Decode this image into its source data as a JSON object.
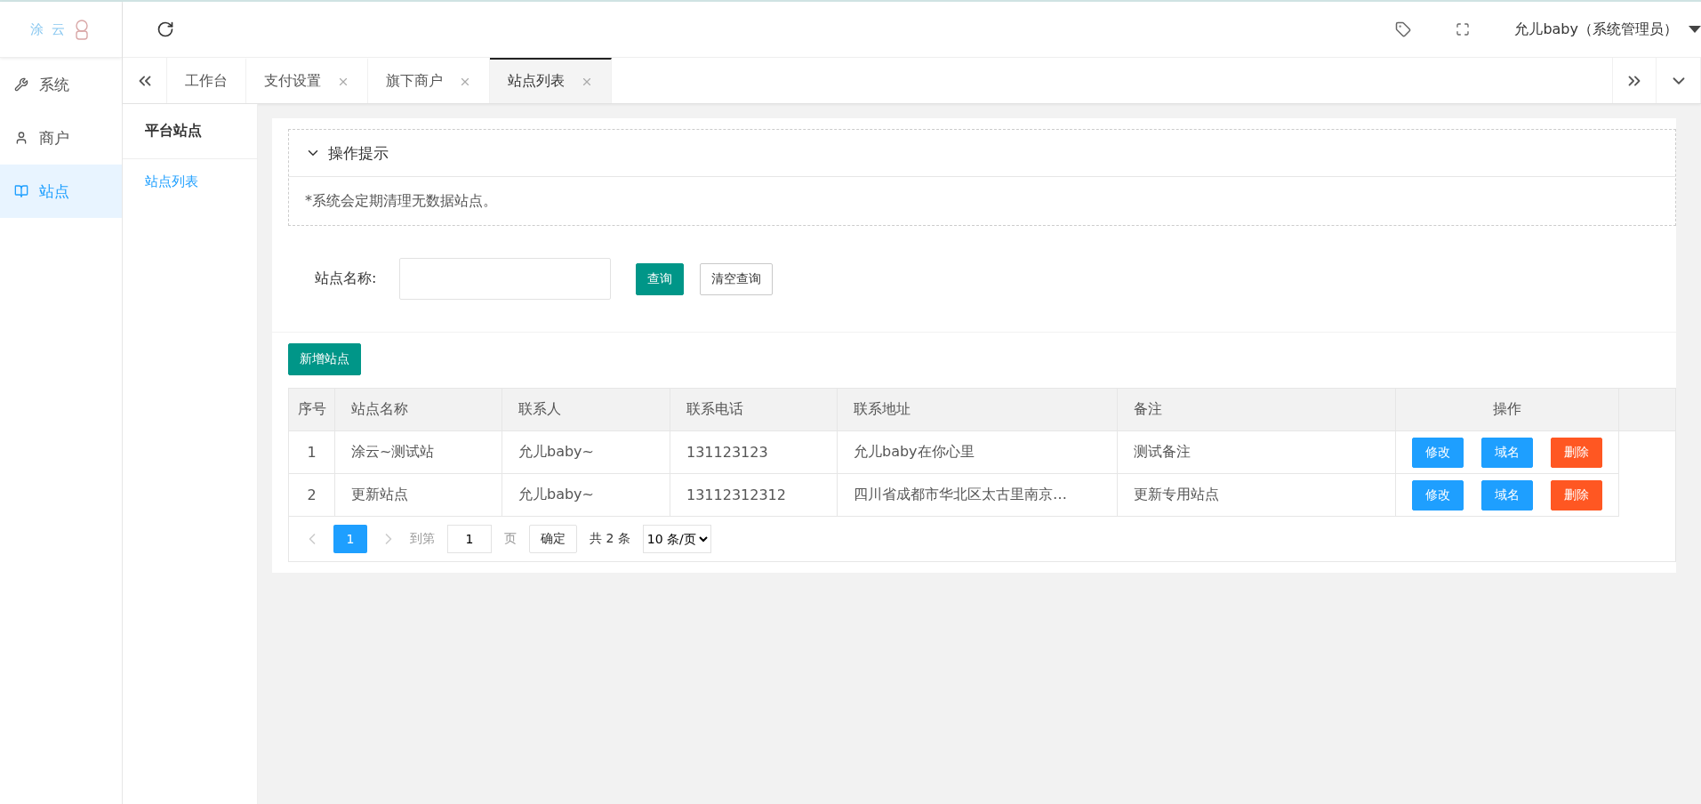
{
  "logo": {
    "text": "涂 云"
  },
  "sidebar": {
    "items": [
      {
        "label": "系统",
        "selected": false
      },
      {
        "label": "商户",
        "selected": false
      },
      {
        "label": "站点",
        "selected": true
      }
    ]
  },
  "header": {
    "user": "允儿baby（系统管理员）"
  },
  "tabs": [
    {
      "label": "工作台",
      "closable": false,
      "selected": false
    },
    {
      "label": "支付设置",
      "closable": true,
      "selected": false
    },
    {
      "label": "旗下商户",
      "closable": true,
      "selected": false
    },
    {
      "label": "站点列表",
      "closable": true,
      "selected": true
    }
  ],
  "subnav": {
    "title": "平台站点",
    "items": [
      {
        "label": "站点列表",
        "selected": true
      }
    ]
  },
  "tip": {
    "title": "操作提示",
    "expanded": true,
    "text": "*系统会定期清理无数据站点。"
  },
  "filter": {
    "label": "站点名称:",
    "search_button": "查询",
    "clear_button": "清空查询"
  },
  "add_button": "新增站点",
  "table": {
    "columns": [
      "序号",
      "站点名称",
      "联系人",
      "联系电话",
      "联系地址",
      "备注",
      "操作"
    ],
    "rows": [
      {
        "cells": [
          "1",
          "涂云~测试站",
          "允儿baby~",
          "131123123",
          "允儿baby在你心里",
          "测试备注"
        ],
        "actions": [
          "修改",
          "域名",
          "删除"
        ]
      },
      {
        "cells": [
          "2",
          "更新站点",
          "允儿baby~",
          "13112312312",
          "四川省成都市华北区太古里南京…",
          "更新专用站点"
        ],
        "actions": [
          "修改",
          "域名",
          "删除"
        ]
      }
    ]
  },
  "pagination": {
    "pages": [
      {
        "label": "1",
        "selected": true
      }
    ],
    "goto_prefix": "到第",
    "goto_value": "1",
    "goto_suffix": "页",
    "confirm": "确定",
    "total": "共 2 条",
    "page_size": "10 条/页"
  }
}
